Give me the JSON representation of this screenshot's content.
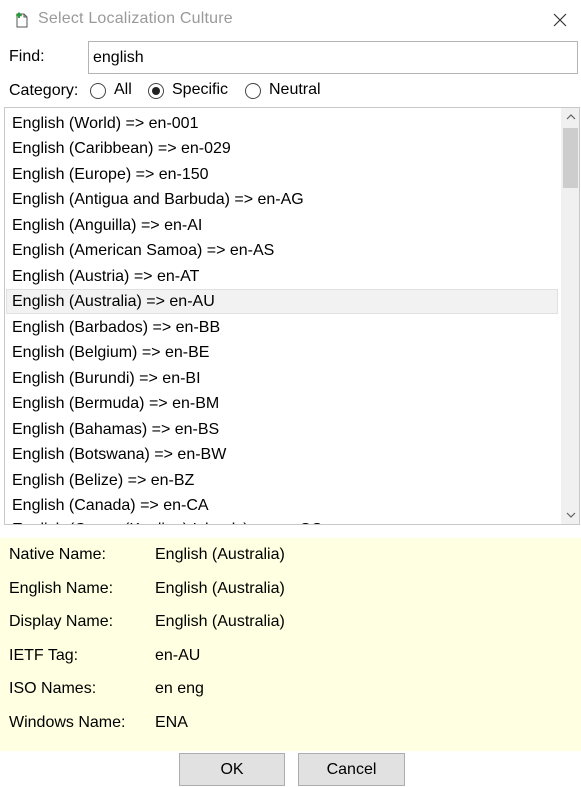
{
  "window": {
    "title": "Select Localization Culture",
    "icon": "new-document-icon"
  },
  "find": {
    "label": "Find:",
    "value": "english"
  },
  "category": {
    "label": "Category:",
    "options": [
      {
        "label": "All",
        "checked": false
      },
      {
        "label": "Specific",
        "checked": true
      },
      {
        "label": "Neutral",
        "checked": false
      }
    ]
  },
  "cultures": [
    "English (World) => en-001",
    "English (Caribbean) => en-029",
    "English (Europe) => en-150",
    "English (Antigua and Barbuda) => en-AG",
    "English (Anguilla) => en-AI",
    "English (American Samoa) => en-AS",
    "English (Austria) => en-AT",
    "English (Australia) => en-AU",
    "English (Barbados) => en-BB",
    "English (Belgium) => en-BE",
    "English (Burundi) => en-BI",
    "English (Bermuda) => en-BM",
    "English (Bahamas) => en-BS",
    "English (Botswana) => en-BW",
    "English (Belize) => en-BZ",
    "English (Canada) => en-CA",
    "English (Cocos (Keeling) Islands) => en-CC"
  ],
  "selected_index": 7,
  "details": {
    "native_name": {
      "label": "Native Name:",
      "value": "English (Australia)"
    },
    "english_name": {
      "label": "English Name:",
      "value": "English (Australia)"
    },
    "display_name": {
      "label": "Display Name:",
      "value": "English (Australia)"
    },
    "ietf_tag": {
      "label": "IETF Tag:",
      "value": "en-AU"
    },
    "iso_names": {
      "label": "ISO Names:",
      "value": "en eng"
    },
    "windows_name": {
      "label": "Windows Name:",
      "value": "ENA"
    }
  },
  "buttons": {
    "ok": "OK",
    "cancel": "Cancel"
  }
}
